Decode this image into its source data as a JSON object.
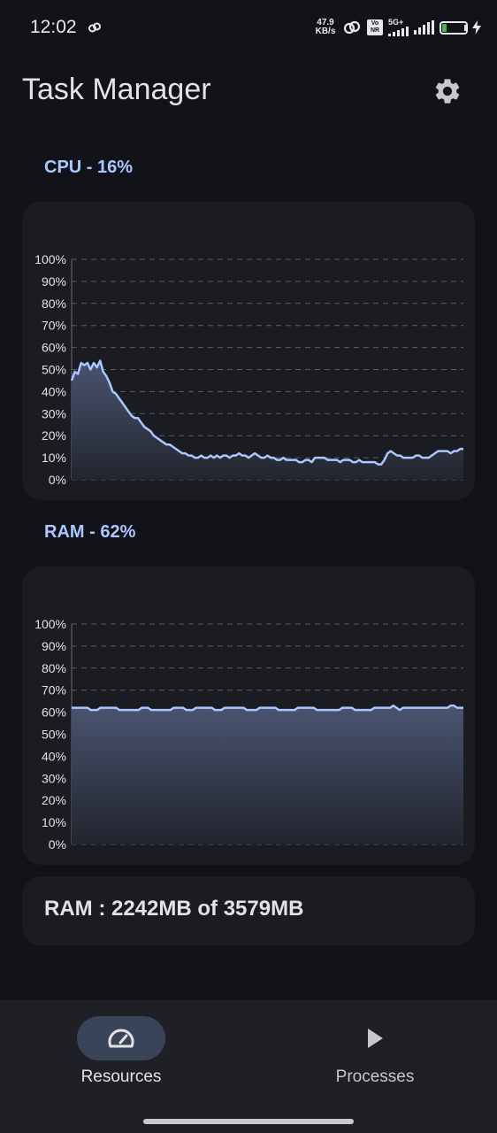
{
  "status_bar": {
    "time": "12:02",
    "net_speed_value": "47.9",
    "net_speed_unit": "KB/s",
    "volte": "Vo NR",
    "network": "5G+",
    "battery_level": "20",
    "battery_fill": 0.2,
    "battery_color": "#4caf50",
    "icons": [
      "link-icon",
      "hotspot-icon",
      "signal-icon",
      "signal-icon",
      "charging-icon"
    ]
  },
  "header": {
    "title": "Task Manager",
    "settings_icon": "gear-icon"
  },
  "cpu": {
    "label": "CPU - 16%"
  },
  "ram": {
    "label": "RAM - 62%",
    "summary": "RAM : 2242MB of 3579MB"
  },
  "colors": {
    "accent": "#aac7ff",
    "line": "#aac7ff",
    "card": "#1a1c22",
    "background": "#111318"
  },
  "chart_data": [
    {
      "type": "area",
      "ylabel": "",
      "xlabel": "",
      "ylim": [
        0,
        100
      ],
      "y_ticks": [
        "0%",
        "10%",
        "20%",
        "30%",
        "40%",
        "50%",
        "60%",
        "70%",
        "80%",
        "90%",
        "100%"
      ],
      "grid": true,
      "series": [
        {
          "values": [
            45,
            49,
            48,
            53,
            52,
            53,
            50,
            53,
            51,
            54,
            49,
            47,
            44,
            40,
            39,
            37,
            35,
            33,
            31,
            29,
            28,
            28,
            26,
            24,
            23,
            22,
            20,
            19,
            18,
            17,
            16,
            16,
            15,
            14,
            13,
            12,
            12,
            11,
            11,
            10,
            10,
            11,
            10,
            10,
            11,
            10,
            11,
            10,
            11,
            11,
            10,
            11,
            11,
            12,
            11,
            11,
            10,
            11,
            12,
            11,
            10,
            10,
            11,
            10,
            10,
            9,
            9,
            10,
            9,
            9,
            9,
            9,
            8,
            8,
            9,
            9,
            8,
            10,
            10,
            10,
            10,
            9,
            9,
            9,
            9,
            8,
            9,
            9,
            9,
            8,
            8,
            9,
            8,
            8,
            8,
            8,
            8,
            7,
            7,
            9,
            12,
            13,
            12,
            11,
            11,
            10,
            10,
            10,
            10,
            11,
            11,
            10,
            10,
            10,
            11,
            12,
            13,
            13,
            13,
            13,
            12,
            13,
            13,
            14,
            14
          ]
        }
      ]
    },
    {
      "type": "area",
      "ylabel": "",
      "xlabel": "",
      "ylim": [
        0,
        100
      ],
      "y_ticks": [
        "0%",
        "10%",
        "20%",
        "30%",
        "40%",
        "50%",
        "60%",
        "70%",
        "80%",
        "90%",
        "100%"
      ],
      "grid": true,
      "series": [
        {
          "values": [
            62,
            62,
            62,
            62,
            62,
            62,
            61,
            61,
            61,
            62,
            62,
            62,
            62,
            62,
            62,
            61,
            61,
            61,
            61,
            61,
            61,
            61,
            62,
            62,
            62,
            61,
            61,
            61,
            61,
            61,
            61,
            61,
            62,
            62,
            62,
            62,
            61,
            61,
            61,
            62,
            62,
            62,
            62,
            62,
            62,
            61,
            61,
            61,
            62,
            62,
            62,
            62,
            62,
            62,
            62,
            61,
            61,
            61,
            61,
            62,
            62,
            62,
            62,
            62,
            62,
            61,
            61,
            61,
            61,
            61,
            61,
            62,
            62,
            62,
            62,
            62,
            62,
            61,
            61,
            61,
            61,
            61,
            61,
            61,
            61,
            62,
            62,
            62,
            62,
            61,
            61,
            61,
            61,
            61,
            61,
            62,
            62,
            62,
            62,
            62,
            62,
            63,
            62,
            61,
            62,
            62,
            62,
            62,
            62,
            62,
            62,
            62,
            62,
            62,
            62,
            62,
            62,
            62,
            62,
            63,
            63,
            62,
            62,
            62
          ]
        }
      ]
    }
  ],
  "bottom_nav": {
    "items": [
      {
        "label": "Resources",
        "icon": "speedometer-icon",
        "active": true
      },
      {
        "label": "Processes",
        "icon": "play-icon",
        "active": false
      }
    ]
  }
}
